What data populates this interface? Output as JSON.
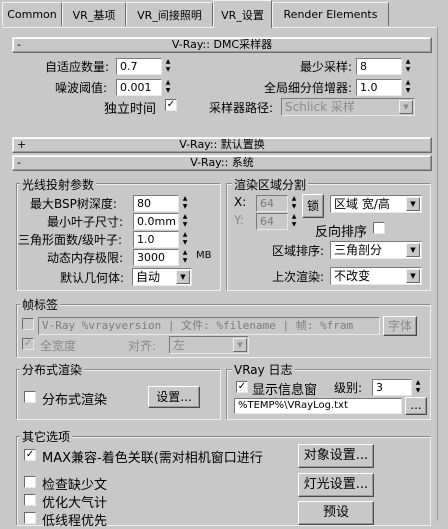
{
  "tabs": [
    {
      "label": "Common"
    },
    {
      "label": "VR_基项"
    },
    {
      "label": "VR_间接照明"
    },
    {
      "label": "VR_设置"
    },
    {
      "label": "Render Elements"
    }
  ],
  "dmc": {
    "header": "V-Ray:: DMC采样器",
    "sign": "-",
    "adaptive_amount_label": "自适应数量:",
    "adaptive_amount_value": "0.7",
    "min_samples_label": "最少采样:",
    "min_samples_value": "8",
    "noise_threshold_label": "噪波阈值:",
    "noise_threshold_value": "0.001",
    "global_subdiv_label": "全局细分倍增器:",
    "global_subdiv_value": "1.0",
    "time_independent_label": "独立时间",
    "time_independent_checked": "✓",
    "sampler_path_label": "采样器路径:",
    "sampler_path_value": "Schlick 采样"
  },
  "displacement": {
    "header": "V-Ray:: 默认置换",
    "sign": "+"
  },
  "system": {
    "header": "V-Ray:: 系统",
    "sign": "-",
    "raycast": {
      "title": "光线投射参数",
      "max_depth_label": "最大BSP树深度:",
      "max_depth_value": "80",
      "min_leaf_label": "最小叶子尺寸:",
      "min_leaf_value": "0.0mm",
      "face_level_label": "三角形面数/级叶子:",
      "face_level_value": "1.0",
      "mem_limit_label": "动态内存极限:",
      "mem_limit_value": "3000",
      "mem_unit": "MB",
      "default_geom_label": "默认几何体:",
      "default_geom_value": "自动"
    },
    "region": {
      "title": "渲染区域分割",
      "x_label": "X:",
      "x_value": "64",
      "y_label": "Y:",
      "y_value": "64",
      "lock_label": "锁",
      "mode_value": "区域 宽/高",
      "reverse_label": "反向排序",
      "order_label": "区域排序:",
      "order_value": "三角剖分",
      "prev_label": "上次渲染:",
      "prev_value": "不改变"
    },
    "stamp": {
      "title": "帧标签",
      "text": "V-Ray %vrayversion | 文件: %filename | 帧: %fram",
      "font_button": "字体",
      "full_width_label": "全宽度",
      "full_width_checked": "✓",
      "justify_label": "对齐:",
      "justify_value": "左"
    },
    "distributed": {
      "title": "分布式渲染",
      "enable_label": "分布式渲染",
      "settings_button": "设置..."
    },
    "log": {
      "title": "VRay 日志",
      "show_window_label": "显示信息窗",
      "show_window_checked": "✓",
      "level_label": "级别:",
      "level_value": "3",
      "path_value": "%TEMP%\\VRayLog.txt",
      "browse_button": "..."
    },
    "misc": {
      "title": "其它选项",
      "max_compat_label": "MAX兼容-着色关联(需对相机窗口进行",
      "max_compat_checked": "✓",
      "check_missing_label": "检查缺少文",
      "opt_atmos_label": "优化大气计",
      "low_thread_label": "低线程优先",
      "object_settings_button": "对象设置...",
      "light_settings_button": "灯光设置...",
      "presets_button": "预设"
    }
  }
}
